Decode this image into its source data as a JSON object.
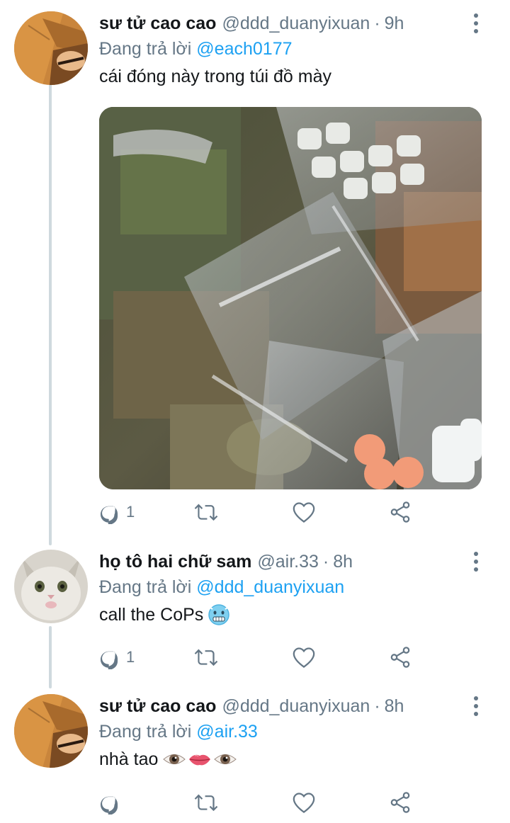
{
  "tweets": [
    {
      "name": "sư tử cao cao",
      "handle": "@ddd_duanyixuan",
      "dot": "·",
      "time": "9h",
      "reply_prefix": "Đang trả lời",
      "reply_to": "@each0177",
      "text": "cái đóng này trong túi đồ mày",
      "reply_count": "1",
      "has_media": true
    },
    {
      "name": "họ tô hai chữ sam",
      "handle": "@air.33",
      "dot": "·",
      "time": "8h",
      "reply_prefix": "Đang trả lời",
      "reply_to": "@ddd_duanyixuan",
      "text": "call the CoPs",
      "emoji": "cold-face",
      "reply_count": "1",
      "has_media": false
    },
    {
      "name": "sư tử cao cao",
      "handle": "@ddd_duanyixuan",
      "dot": "·",
      "time": "8h",
      "reply_prefix": "Đang trả lời",
      "reply_to": "@air.33",
      "text": "nhà tao",
      "emoji": "eye-lips-eye",
      "reply_count": "",
      "has_media": false
    }
  ],
  "icons": {
    "reply": "reply-icon",
    "retweet": "retweet-icon",
    "like": "heart-icon",
    "share": "share-icon",
    "menu": "more-vertical-icon"
  },
  "colors": {
    "link": "#1da1f2",
    "secondary": "#657786",
    "thread_line": "#cfd9de"
  }
}
